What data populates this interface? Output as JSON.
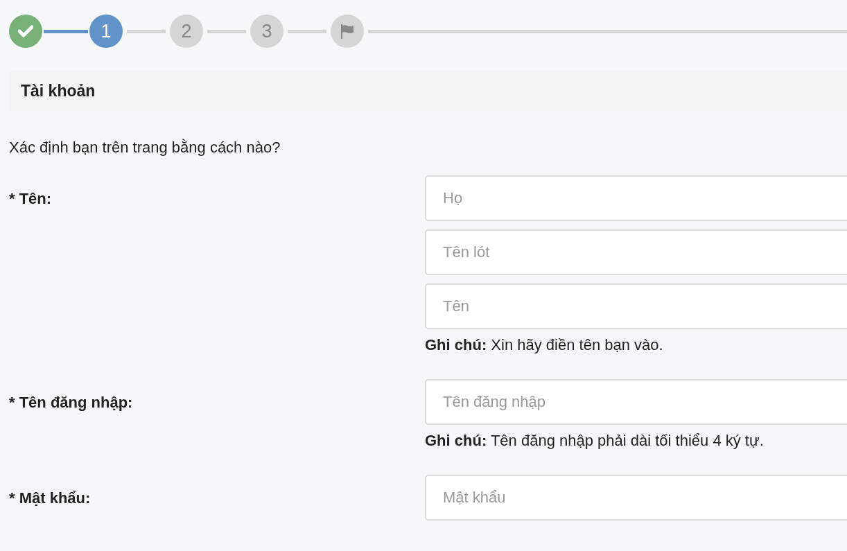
{
  "stepper": {
    "steps": [
      {
        "kind": "done"
      },
      {
        "kind": "current",
        "label": "1"
      },
      {
        "kind": "todo",
        "label": "2"
      },
      {
        "kind": "todo",
        "label": "3"
      },
      {
        "kind": "finish"
      }
    ]
  },
  "section": {
    "title": "Tài khoản"
  },
  "question": "Xác định bạn trên trang bằng cách nào?",
  "groups": [
    {
      "label": "* Tên:",
      "fields": [
        {
          "placeholder": "Họ"
        },
        {
          "placeholder": "Tên lót"
        },
        {
          "placeholder": "Tên"
        }
      ],
      "note": "**Ghi chú:** Xin hãy điền tên bạn vào."
    },
    {
      "label": "* Tên đăng nhập:",
      "fields": [
        {
          "placeholder": "Tên đăng nhập"
        }
      ],
      "note": "**Ghi chú:** Tên đăng nhập phải dài tối thiểu 4 ký tự."
    },
    {
      "label": "* Mật khẩu:",
      "fields": [
        {
          "placeholder": "Mật khẩu"
        }
      ]
    }
  ]
}
